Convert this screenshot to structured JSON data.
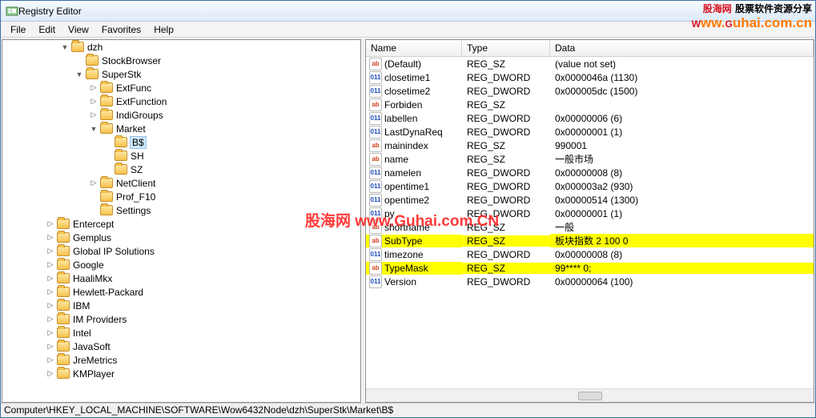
{
  "window": {
    "title": "Registry Editor"
  },
  "menu": [
    "File",
    "Edit",
    "View",
    "Favorites",
    "Help"
  ],
  "statusbar": "Computer\\HKEY_LOCAL_MACHINE\\SOFTWARE\\Wow6432Node\\dzh\\SuperStk\\Market\\B$",
  "tree": [
    {
      "d": 4,
      "exp": "▼",
      "label": "dzh"
    },
    {
      "d": 5,
      "exp": "",
      "label": "StockBrowser"
    },
    {
      "d": 5,
      "exp": "▼",
      "label": "SuperStk"
    },
    {
      "d": 6,
      "exp": "▷",
      "label": "ExtFunc"
    },
    {
      "d": 6,
      "exp": "▷",
      "label": "ExtFunction"
    },
    {
      "d": 6,
      "exp": "▷",
      "label": "IndiGroups"
    },
    {
      "d": 6,
      "exp": "▼",
      "label": "Market"
    },
    {
      "d": 7,
      "exp": "",
      "label": "B$",
      "selected": true
    },
    {
      "d": 7,
      "exp": "",
      "label": "SH"
    },
    {
      "d": 7,
      "exp": "",
      "label": "SZ"
    },
    {
      "d": 6,
      "exp": "▷",
      "label": "NetClient"
    },
    {
      "d": 6,
      "exp": "",
      "label": "Prof_F10"
    },
    {
      "d": 6,
      "exp": "",
      "label": "Settings"
    },
    {
      "d": 3,
      "exp": "▷",
      "label": "Entercept"
    },
    {
      "d": 3,
      "exp": "▷",
      "label": "Gemplus"
    },
    {
      "d": 3,
      "exp": "▷",
      "label": "Global IP Solutions"
    },
    {
      "d": 3,
      "exp": "▷",
      "label": "Google"
    },
    {
      "d": 3,
      "exp": "▷",
      "label": "HaaliMkx"
    },
    {
      "d": 3,
      "exp": "▷",
      "label": "Hewlett-Packard"
    },
    {
      "d": 3,
      "exp": "▷",
      "label": "IBM"
    },
    {
      "d": 3,
      "exp": "▷",
      "label": "IM Providers"
    },
    {
      "d": 3,
      "exp": "▷",
      "label": "Intel"
    },
    {
      "d": 3,
      "exp": "▷",
      "label": "JavaSoft"
    },
    {
      "d": 3,
      "exp": "▷",
      "label": "JreMetrics"
    },
    {
      "d": 3,
      "exp": "▷",
      "label": "KMPlayer"
    }
  ],
  "columns": {
    "name": "Name",
    "type": "Type",
    "data": "Data"
  },
  "values": [
    {
      "kind": "sz",
      "name": "(Default)",
      "type": "REG_SZ",
      "data": "(value not set)"
    },
    {
      "kind": "dw",
      "name": "closetime1",
      "type": "REG_DWORD",
      "data": "0x0000046a (1130)"
    },
    {
      "kind": "dw",
      "name": "closetime2",
      "type": "REG_DWORD",
      "data": "0x000005dc (1500)"
    },
    {
      "kind": "sz",
      "name": "Forbiden",
      "type": "REG_SZ",
      "data": ""
    },
    {
      "kind": "dw",
      "name": "labellen",
      "type": "REG_DWORD",
      "data": "0x00000006 (6)"
    },
    {
      "kind": "dw",
      "name": "LastDynaReq",
      "type": "REG_DWORD",
      "data": "0x00000001 (1)"
    },
    {
      "kind": "sz",
      "name": "mainindex",
      "type": "REG_SZ",
      "data": "990001"
    },
    {
      "kind": "sz",
      "name": "name",
      "type": "REG_SZ",
      "data": "一般市场"
    },
    {
      "kind": "dw",
      "name": "namelen",
      "type": "REG_DWORD",
      "data": "0x00000008 (8)"
    },
    {
      "kind": "dw",
      "name": "opentime1",
      "type": "REG_DWORD",
      "data": "0x000003a2 (930)"
    },
    {
      "kind": "dw",
      "name": "opentime2",
      "type": "REG_DWORD",
      "data": "0x00000514 (1300)"
    },
    {
      "kind": "dw",
      "name": "py",
      "type": "REG_DWORD",
      "data": "0x00000001 (1)"
    },
    {
      "kind": "sz",
      "name": "shortname",
      "type": "REG_SZ",
      "data": "一般"
    },
    {
      "kind": "sz",
      "name": "SubType",
      "type": "REG_SZ",
      "data": "板块指数 2 100 0",
      "hl": true
    },
    {
      "kind": "dw",
      "name": "timezone",
      "type": "REG_DWORD",
      "data": "0x00000008 (8)"
    },
    {
      "kind": "sz",
      "name": "TypeMask",
      "type": "REG_SZ",
      "data": "99**** 0;",
      "hl": true
    },
    {
      "kind": "dw",
      "name": "Version",
      "type": "REG_DWORD",
      "data": "0x00000064 (100)"
    }
  ],
  "watermark": {
    "center": "股海网 www.Guhai.com.CN",
    "top_a": "股海网",
    "top_b": "股票软件资源分享",
    "top_c": "Www.Guhai.com.cn"
  }
}
